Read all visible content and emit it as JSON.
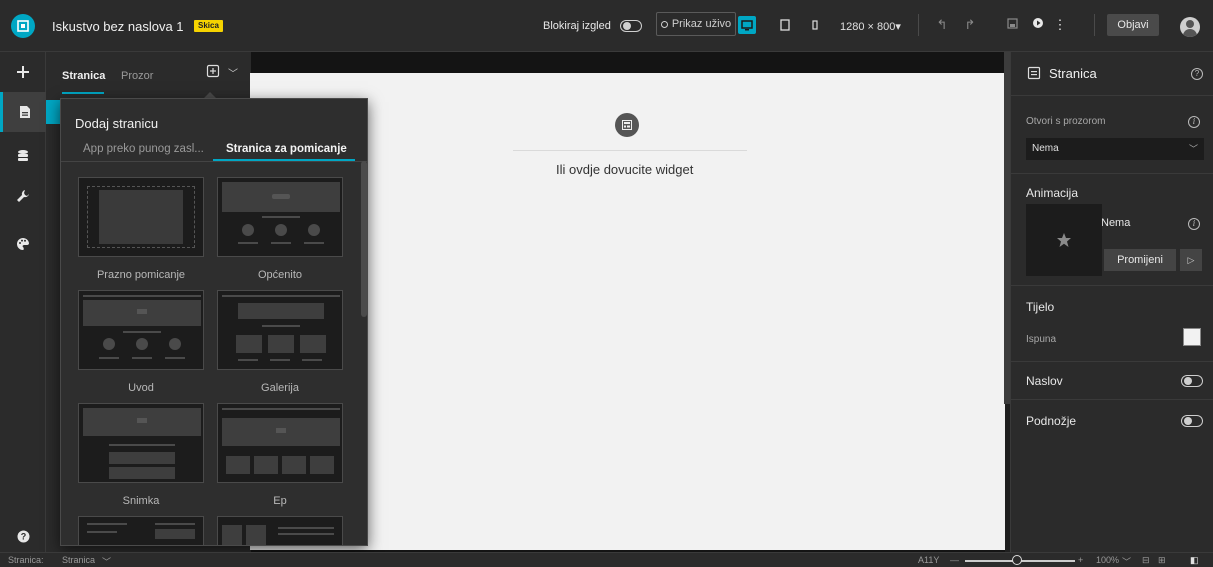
{
  "header": {
    "title": "Iskustvo bez naslova 1",
    "badge": "Skica",
    "lock_layout_label": "Blokiraj izgled",
    "live_view_label": "Prikaz uživo",
    "resolution": "1280 × 800",
    "publish_label": "Objavi"
  },
  "left_panel": {
    "tabs": [
      {
        "label": "Stranica"
      },
      {
        "label": "Prozor"
      }
    ]
  },
  "add_page": {
    "title": "Dodaj stranicu",
    "tabs": [
      {
        "label": "App preko punog zasl..."
      },
      {
        "label": "Stranica za pomicanje"
      }
    ],
    "active_tab": 1,
    "templates": [
      {
        "label": "Prazno pomicanje"
      },
      {
        "label": "Općenito"
      },
      {
        "label": "Uvod"
      },
      {
        "label": "Galerija"
      },
      {
        "label": "Snimka"
      },
      {
        "label": "Ep"
      }
    ]
  },
  "canvas": {
    "drop_hint": "Ili ovdje dovucite widget"
  },
  "right_panel": {
    "title": "Stranica",
    "open_with_window_label": "Otvori s prozorom",
    "open_with_window_value": "Nema",
    "animation_label": "Animacija",
    "animation_value": "Nema",
    "change_label": "Promijeni",
    "body_label": "Tijelo",
    "fill_label": "Ispuna",
    "header_label": "Naslov",
    "footer_label": "Podnožje"
  },
  "footer": {
    "page_prefix": "Stranica:",
    "page_value": "Stranica",
    "a11y": "A11Y",
    "zoom": "100%"
  },
  "colors": {
    "accent": "#00a7c4",
    "badge": "#f6d300"
  }
}
